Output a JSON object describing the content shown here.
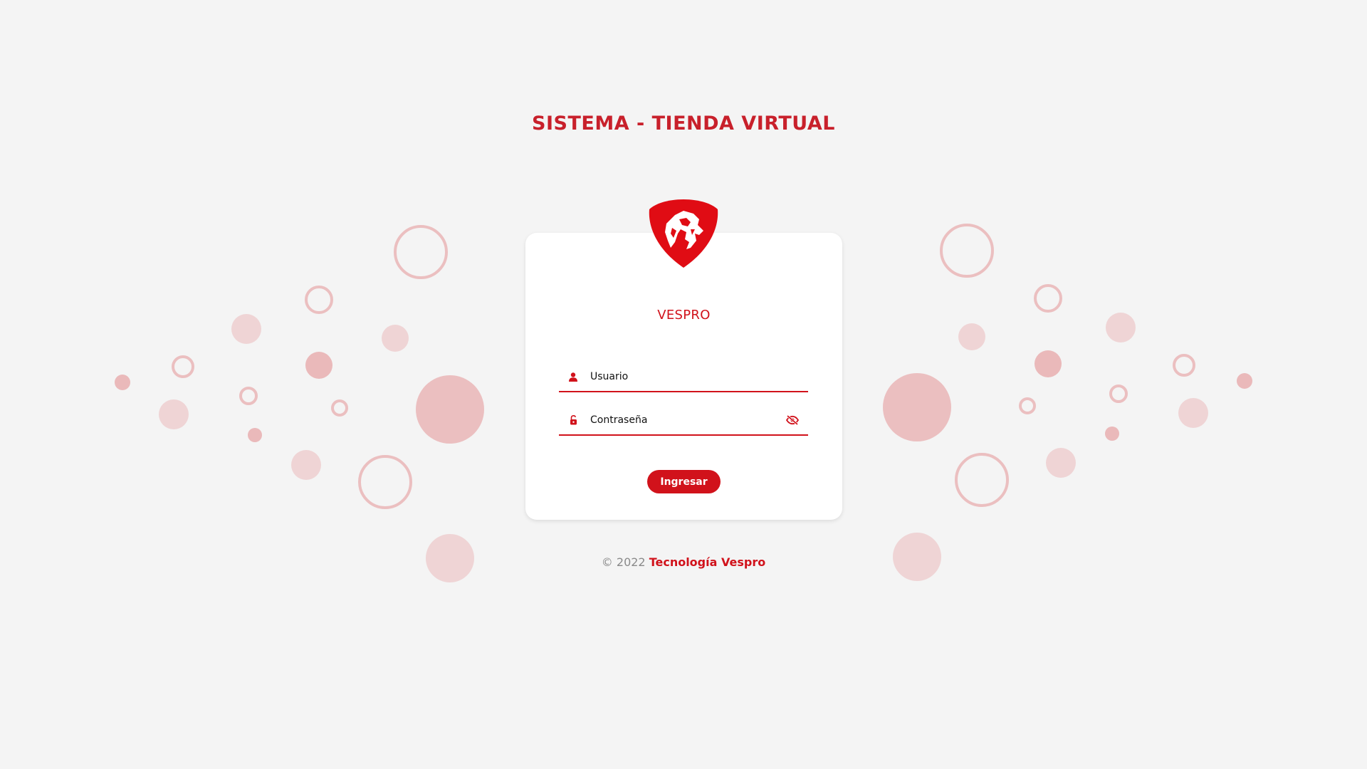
{
  "page": {
    "title": "SISTEMA - TIENDA VIRTUAL"
  },
  "login": {
    "logo_icon": "lion-shield-logo-icon",
    "brand": "VESPRO",
    "username_placeholder": "Usuario",
    "password_placeholder": "Contraseña",
    "submit_label": "Ingresar",
    "user_icon": "user-icon",
    "lock_icon": "unlock-icon",
    "toggle_icon": "eye-slash-icon"
  },
  "footer": {
    "copyright": "© 2022 ",
    "company": "Tecnología Vespro"
  },
  "colors": {
    "accent": "#d1121b",
    "title": "#c8202b",
    "background": "#f4f4f4",
    "bubble": "#e8a9aa"
  }
}
